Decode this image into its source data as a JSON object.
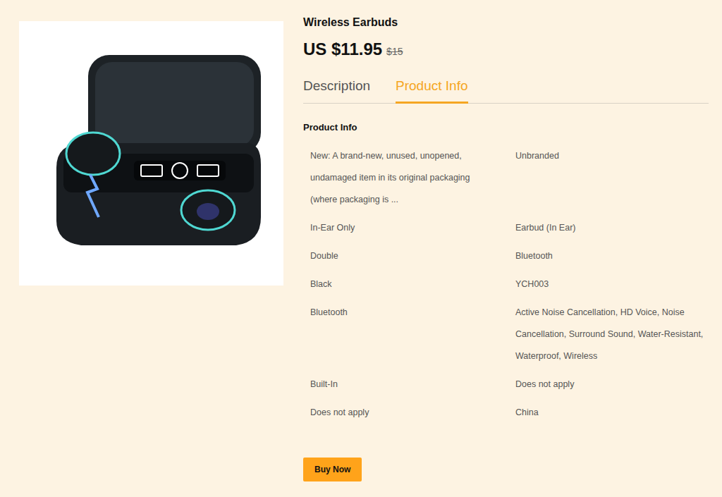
{
  "product": {
    "title": "Wireless Earbuds",
    "price": "US $11.95",
    "old_price": "$15"
  },
  "tabs": [
    {
      "label": "Description",
      "selected": false
    },
    {
      "label": "Product Info",
      "selected": true
    }
  ],
  "section_title": "Product Info",
  "specs": [
    {
      "left": "New: A brand-new, unused, unopened, undamaged item in its original packaging (where packaging is ...",
      "right": "Unbranded"
    },
    {
      "left": "In-Ear Only",
      "right": "Earbud (In Ear)"
    },
    {
      "left": "Double",
      "right": "Bluetooth"
    },
    {
      "left": "Black",
      "right": "YCH003"
    },
    {
      "left": "Bluetooth",
      "right": "Active Noise Cancellation, HD Voice, Noise Cancellation, Surround Sound, Water-Resistant, Waterproof, Wireless"
    },
    {
      "left": "Built-In",
      "right": "Does not apply"
    },
    {
      "left": "Does not apply",
      "right": "China"
    }
  ],
  "buttons": [
    "Buy Now"
  ]
}
